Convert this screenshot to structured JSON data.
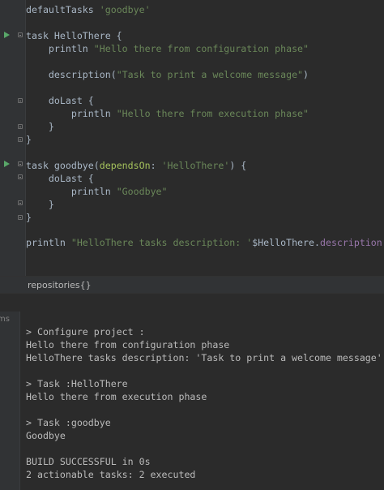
{
  "editor": {
    "lines": {
      "default_tasks": {
        "kw": "defaultTasks ",
        "arg": "'goodbye'"
      },
      "task_hello": {
        "text": "task HelloThere {"
      },
      "println_config": {
        "kw": "    println ",
        "arg": "\"Hello there from configuration phase\""
      },
      "description": {
        "kw": "    description(",
        "arg": "\"Task to print a welcome message\"",
        "close": ")"
      },
      "dolast_1": {
        "text": "    doLast {"
      },
      "println_exec": {
        "kw": "        println ",
        "arg": "\"Hello there from execution phase\""
      },
      "close_1": {
        "text": "    }"
      },
      "close_2": {
        "text": "}"
      },
      "task_goodbye": {
        "pre": "task goodbye(",
        "named": "dependsOn",
        "colon": ": ",
        "arg": "'HelloThere'",
        "post": ") {"
      },
      "dolast_2": {
        "text": "    doLast {"
      },
      "println_goodbye": {
        "kw": "        println ",
        "arg": "\"Goodbye\""
      },
      "close_3": {
        "text": "    }"
      },
      "close_4": {
        "text": "}"
      },
      "println_desc": {
        "kw": "println ",
        "arg1": "\"HelloThere tasks description: '",
        "var": "$HelloThere.",
        "prop": "description",
        "arg2": "'\""
      }
    },
    "icons": {
      "run": "run-play-icon",
      "fold": "fold-icon"
    },
    "colors": {
      "keyword": "#a9b7c6",
      "string": "#6a8759",
      "property": "#9876aa",
      "named_arg": "#a5c25c",
      "run": "#59a869"
    }
  },
  "breadcrumb": {
    "label": "repositories{}"
  },
  "console": {
    "side_label": "ms",
    "lines": [
      "> Configure project :",
      "Hello there from configuration phase",
      "HelloThere tasks description: 'Task to print a welcome message'",
      "",
      "> Task :HelloThere",
      "Hello there from execution phase",
      "",
      "> Task :goodbye",
      "Goodbye",
      "",
      "BUILD SUCCESSFUL in 0s",
      "2 actionable tasks: 2 executed"
    ]
  }
}
